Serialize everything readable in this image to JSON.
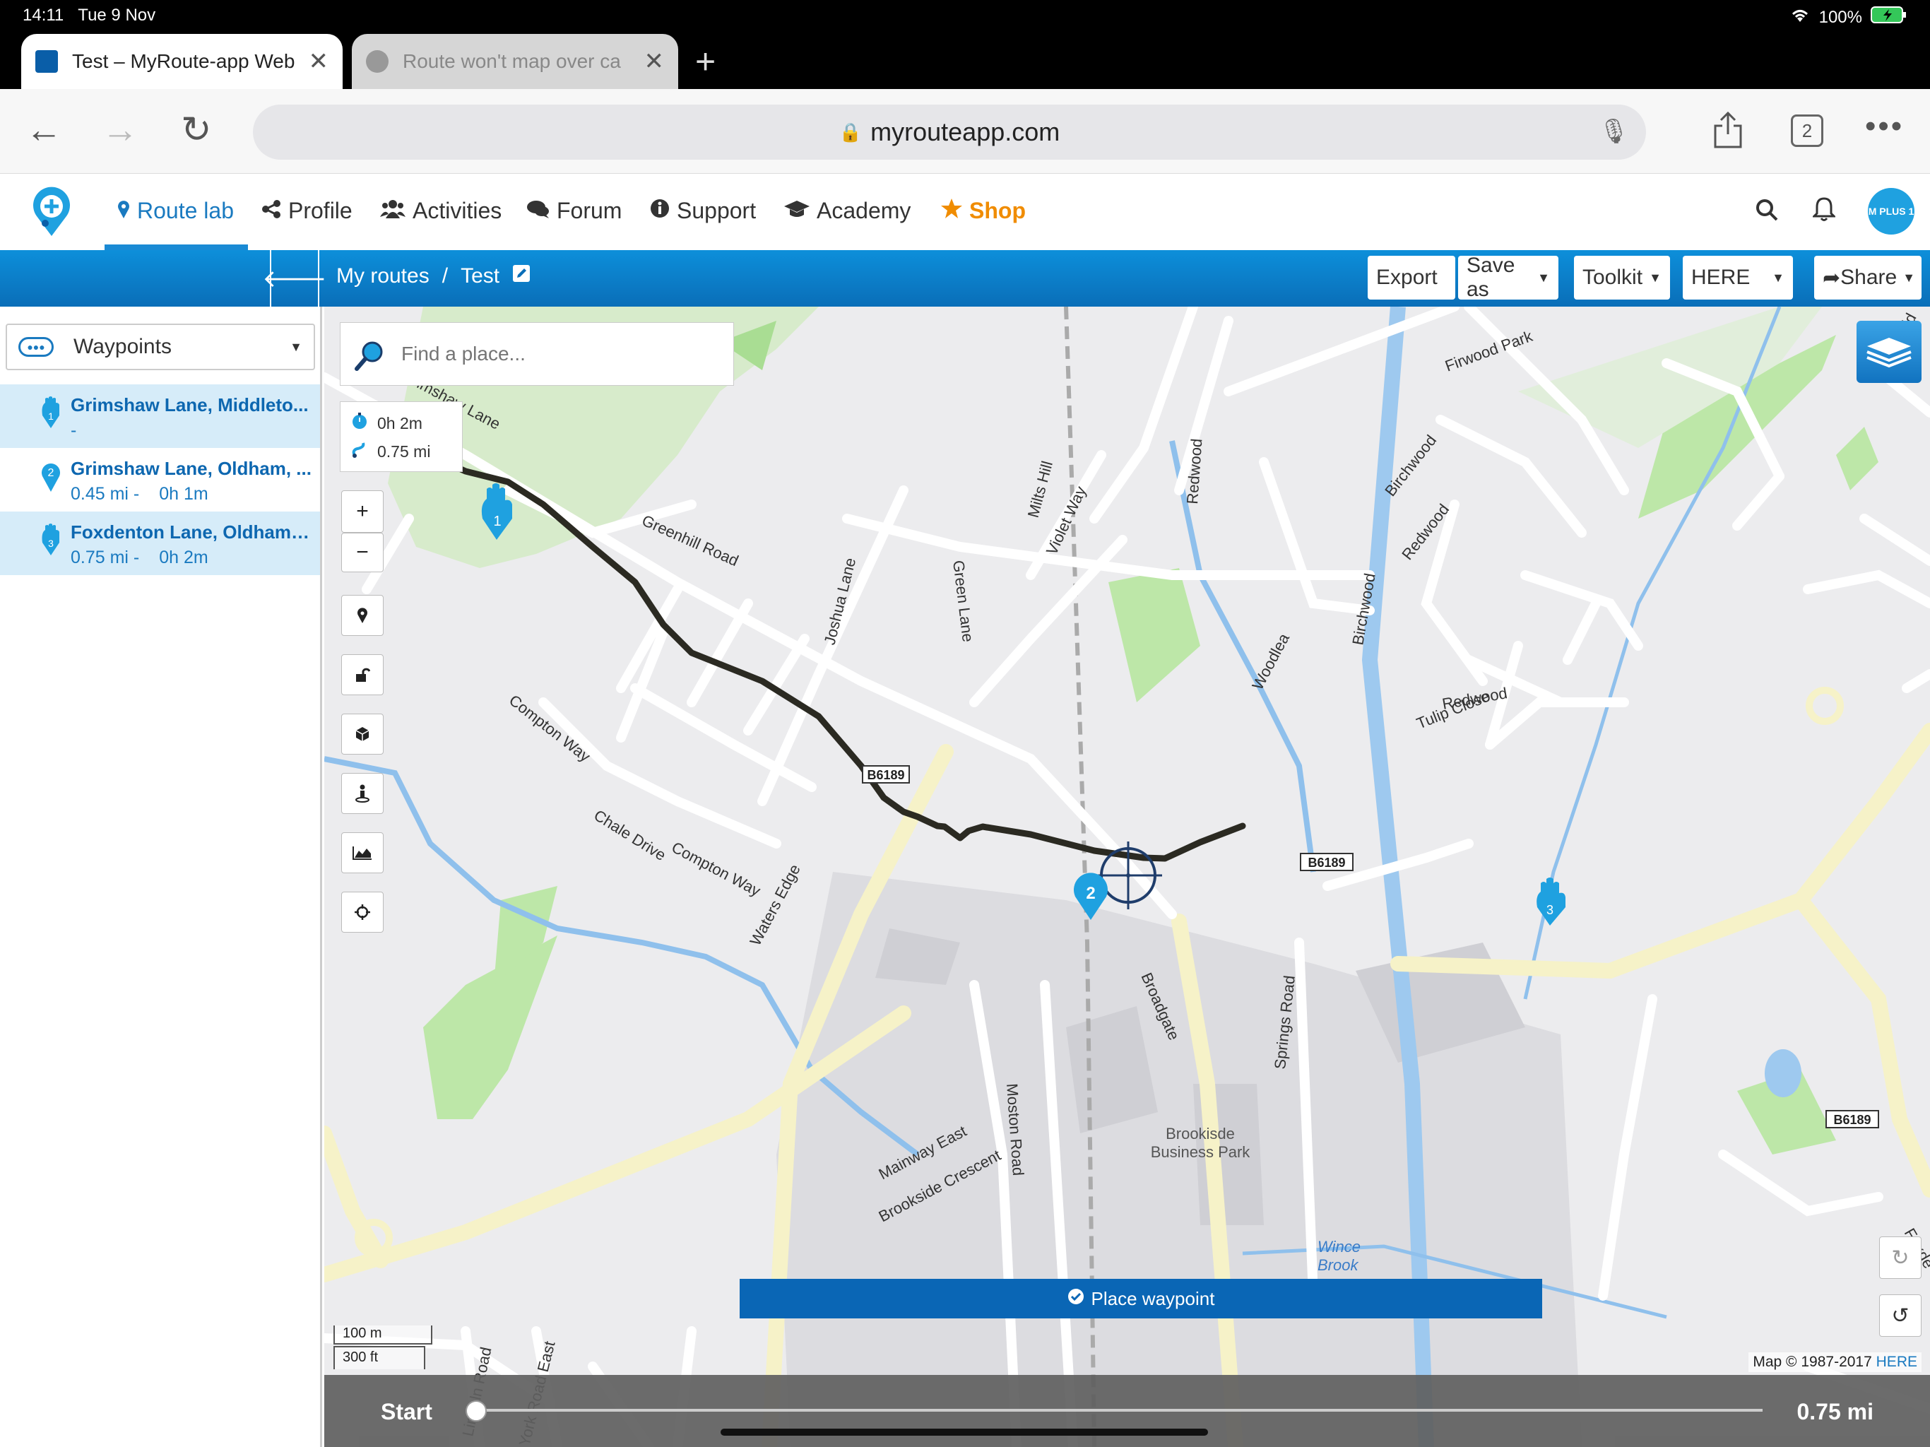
{
  "status_bar": {
    "time": "14:11",
    "date": "Tue 9 Nov",
    "battery": "100%"
  },
  "browser": {
    "tabs": [
      {
        "title": "Test – MyRoute-app Web",
        "active": true
      },
      {
        "title": "Route won't map over ca",
        "active": false
      }
    ],
    "url": "myrouteapp.com",
    "tab_count": "2"
  },
  "app_nav": {
    "items": [
      {
        "label": "Route lab",
        "icon": "map-pin-icon"
      },
      {
        "label": "Profile",
        "icon": "share-nodes-icon"
      },
      {
        "label": "Activities",
        "icon": "users-icon"
      },
      {
        "label": "Forum",
        "icon": "comments-icon"
      },
      {
        "label": "Support",
        "icon": "info-circle-icon"
      },
      {
        "label": "Academy",
        "icon": "graduation-cap-icon"
      },
      {
        "label": "Shop",
        "icon": "star-icon"
      }
    ],
    "avatar_text": "M PLUS 1"
  },
  "route_bar": {
    "breadcrumb_root": "My routes",
    "breadcrumb_sep": "/",
    "route_name": "Test",
    "buttons": {
      "export": "Export",
      "save_as": "Save as",
      "toolkit": "Toolkit",
      "map_provider": "HERE",
      "share": "Share"
    }
  },
  "sidebar": {
    "select_label": "Waypoints",
    "waypoints": [
      {
        "number": "1",
        "name": "Grimshaw Lane, Middleto...",
        "distance": "-",
        "time": ""
      },
      {
        "number": "2",
        "name": "Grimshaw Lane, Oldham, ...",
        "distance": "0.45 mi -",
        "time": "0h 1m"
      },
      {
        "number": "3",
        "name": "Foxdenton Lane, Oldham, ...",
        "distance": "0.75 mi -",
        "time": "0h 2m"
      }
    ]
  },
  "map": {
    "search_placeholder": "Find a place...",
    "stats": {
      "time": "0h 2m",
      "distance": "0.75 mi"
    },
    "place_waypoint": "Place waypoint",
    "scale": {
      "metric": "100 m",
      "imperial": "300 ft"
    },
    "copyright": "Map © 1987-2017",
    "copyright_link": "HERE",
    "labels": {
      "grimshaw_lane": "Grimshaw Lane",
      "greenhill_road": "Greenhill Road",
      "joshua_lane": "Joshua Lane",
      "green_lane": "Green Lane",
      "milts_hill": "Milts Hill",
      "violet_way": "Violet Way",
      "redwood": "Redwood",
      "birchwood": "Birchwood",
      "firwood_park": "Firwood Park",
      "woodlea": "Woodlea",
      "tulip_close": "Tulip Close",
      "compton_way": "Compton Way",
      "chale_drive": "Chale Drive",
      "waters_edge": "Waters Edge",
      "b6189": "B6189",
      "broadgate": "Broadgate",
      "springs_road": "Springs Road",
      "moston_road": "Moston Road",
      "business_park": "Brookisde",
      "business_park_2": "Business Park",
      "mainway_east": "Mainway East",
      "brookside_crescent": "Brookside Crescent",
      "wince_brook": "Wince",
      "wince_brook_2": "Brook",
      "lincoln_road": "Lincoln Road",
      "york_road_east": "York Road East",
      "foxdenton": "Foxde",
      "fernfield": "Fernfield"
    },
    "route_color": "#2b2a22"
  },
  "bottom_bar": {
    "start_label": "Start",
    "end_value": "0.75 mi",
    "progress": 0
  },
  "colors": {
    "brand_blue": "#0a6eb8",
    "shop_orange": "#f08c00",
    "waypoint_blue": "#1fa1e0"
  }
}
